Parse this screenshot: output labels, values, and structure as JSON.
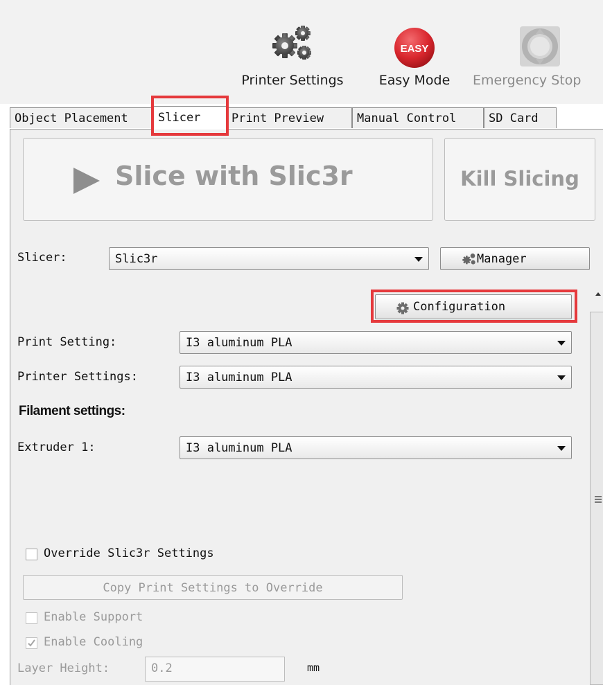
{
  "toolbar": {
    "printer_settings_label": "Printer Settings",
    "easy_mode_label": "Easy Mode",
    "easy_badge": "EASY",
    "emergency_stop_label": "Emergency Stop"
  },
  "tabs": [
    {
      "label": "Object Placement"
    },
    {
      "label": "Slicer"
    },
    {
      "label": "Print Preview"
    },
    {
      "label": "Manual Control"
    },
    {
      "label": "SD Card"
    }
  ],
  "active_tab": "Slicer",
  "slicer": {
    "slice_button_label": "Slice with Slic3r",
    "kill_button_label": "Kill Slicing",
    "slicer_label": "Slicer:",
    "slicer_value": "Slic3r",
    "manager_label": "Manager",
    "configuration_label": "Configuration",
    "print_setting_label": "Print Setting:",
    "print_setting_value": "I3 aluminum PLA",
    "printer_settings_label": "Printer Settings:",
    "printer_settings_value": "I3 aluminum PLA",
    "filament_heading": "Filament settings:",
    "extruder1_label": "Extruder 1:",
    "extruder1_value": "I3 aluminum PLA",
    "override_label": "Override Slic3r Settings",
    "override_checked": false,
    "copy_button_label": "Copy Print Settings to Override",
    "enable_support_label": "Enable Support",
    "enable_support_checked": false,
    "enable_cooling_label": "Enable Cooling",
    "enable_cooling_checked": true,
    "layer_height_label": "Layer Height:",
    "layer_height_value": "0.2",
    "layer_height_unit": "mm"
  },
  "colors": {
    "highlight": "#e5393c",
    "easy_badge": "#d9272e",
    "panel_bg": "#f0f0f0",
    "disabled_text": "#9a9a9a"
  },
  "icons": [
    "gears-icon",
    "easy-mode-icon",
    "emergency-stop-icon",
    "play-icon",
    "gear-icon",
    "dropdown-arrow-icon",
    "checkmark-icon"
  ]
}
